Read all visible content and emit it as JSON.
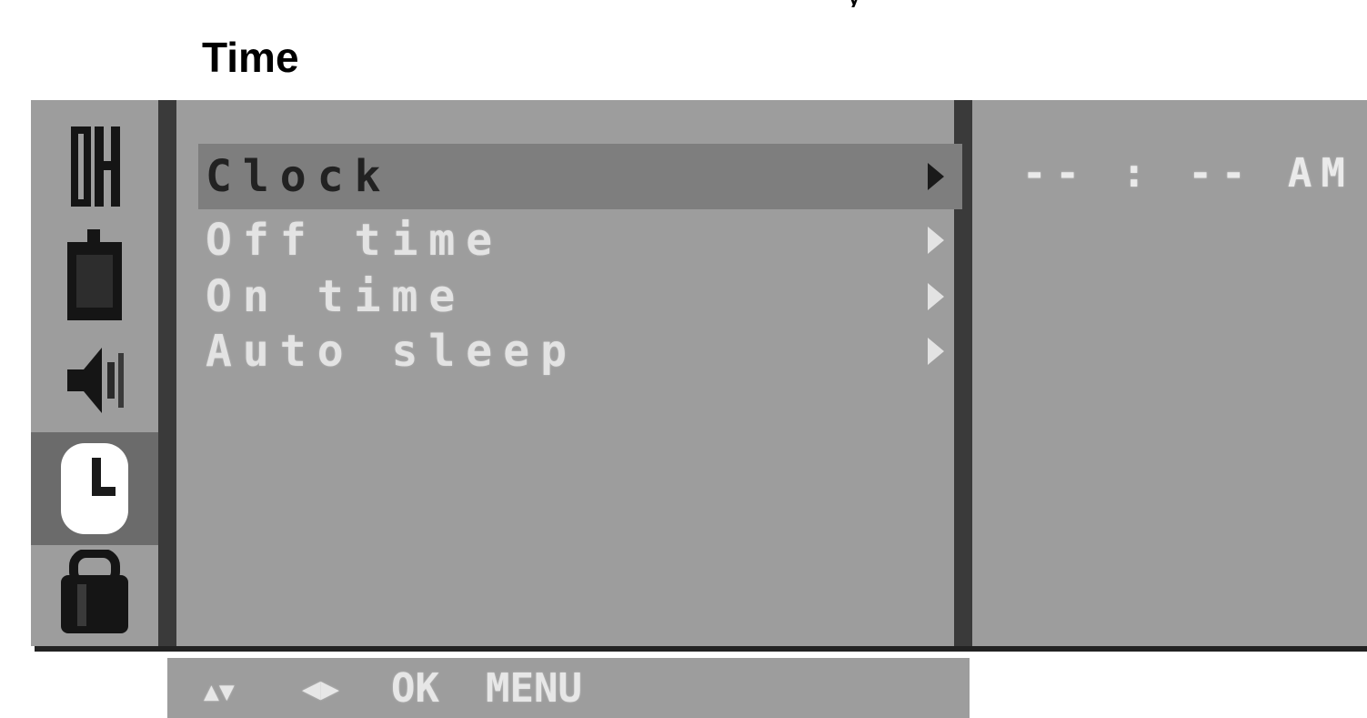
{
  "page_title": "Time",
  "sidebar": {
    "icons": [
      {
        "name": "ch-icon",
        "label": "CH",
        "active": false
      },
      {
        "name": "picture-icon",
        "active": false
      },
      {
        "name": "speaker-icon",
        "active": false
      },
      {
        "name": "clock-icon",
        "active": true
      },
      {
        "name": "lock-icon",
        "active": false
      }
    ]
  },
  "menu": {
    "items": [
      {
        "label": "Clock",
        "selected": true
      },
      {
        "label": "Off time",
        "selected": false
      },
      {
        "label": "On time",
        "selected": false
      },
      {
        "label": "Auto sleep",
        "selected": false
      }
    ]
  },
  "value_panel": {
    "clock_value": "-- : -- AM"
  },
  "help_bar": {
    "nav_updown": "▲▼",
    "nav_leftright": "◀▶",
    "ok": "OK",
    "menu": "MENU"
  },
  "colors": {
    "osd_background": "#9d9d9d",
    "divider": "#3a3a3a",
    "selected_row": "#7e7e7e",
    "active_icon_bg": "#6b6b6b"
  }
}
